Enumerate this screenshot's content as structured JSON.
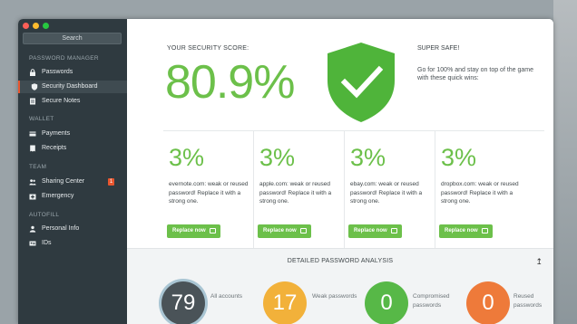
{
  "sidebar": {
    "search": "Search",
    "sections": [
      {
        "title": "PASSWORD MANAGER",
        "items": [
          {
            "label": "Passwords",
            "icon": "lock-icon"
          },
          {
            "label": "Security Dashboard",
            "icon": "shield-icon",
            "active": true
          },
          {
            "label": "Secure Notes",
            "icon": "note-icon"
          }
        ]
      },
      {
        "title": "WALLET",
        "items": [
          {
            "label": "Payments",
            "icon": "card-icon"
          },
          {
            "label": "Receipts",
            "icon": "receipt-icon"
          }
        ]
      },
      {
        "title": "TEAM",
        "items": [
          {
            "label": "Sharing Center",
            "icon": "people-icon",
            "badge": "1"
          },
          {
            "label": "Emergency",
            "icon": "emergency-icon"
          }
        ]
      },
      {
        "title": "AUTOFILL",
        "items": [
          {
            "label": "Personal Info",
            "icon": "person-icon"
          },
          {
            "label": "IDs",
            "icon": "id-icon"
          }
        ]
      }
    ]
  },
  "score": {
    "label": "YOUR SECURITY SCORE:",
    "value": "80.9%",
    "status_title": "SUPER SAFE!",
    "status_desc": "Go for 100% and stay on top of the game with these quick wins:"
  },
  "quick_wins": [
    {
      "percent": "3%",
      "text": "evernote.com: weak or reused password! Replace it with a strong one.",
      "button": "Replace now"
    },
    {
      "percent": "3%",
      "text": "apple.com: weak or reused password! Replace it with a strong one.",
      "button": "Replace now"
    },
    {
      "percent": "3%",
      "text": "ebay.com: weak or reused password! Replace it with a strong one.",
      "button": "Replace now"
    },
    {
      "percent": "3%",
      "text": "dropbox.com: weak or reused password! Replace it with a strong one.",
      "button": "Replace now"
    }
  ],
  "analysis": {
    "title": "DETAILED PASSWORD ANALYSIS",
    "stats": [
      {
        "value": "79",
        "label": "All accounts",
        "color": "#4a5358",
        "ring": "#a9c5d3"
      },
      {
        "value": "17",
        "label": "Weak passwords",
        "color": "#f2b13a"
      },
      {
        "value": "0",
        "label": "Compromised passwords",
        "color": "#57b847"
      },
      {
        "value": "0",
        "label": "Reused passwords",
        "color": "#ee7a3a"
      }
    ]
  },
  "colors": {
    "accent_green": "#6cc04a",
    "active_marker": "#e8562f",
    "sidebar_bg": "#2f3a40"
  }
}
